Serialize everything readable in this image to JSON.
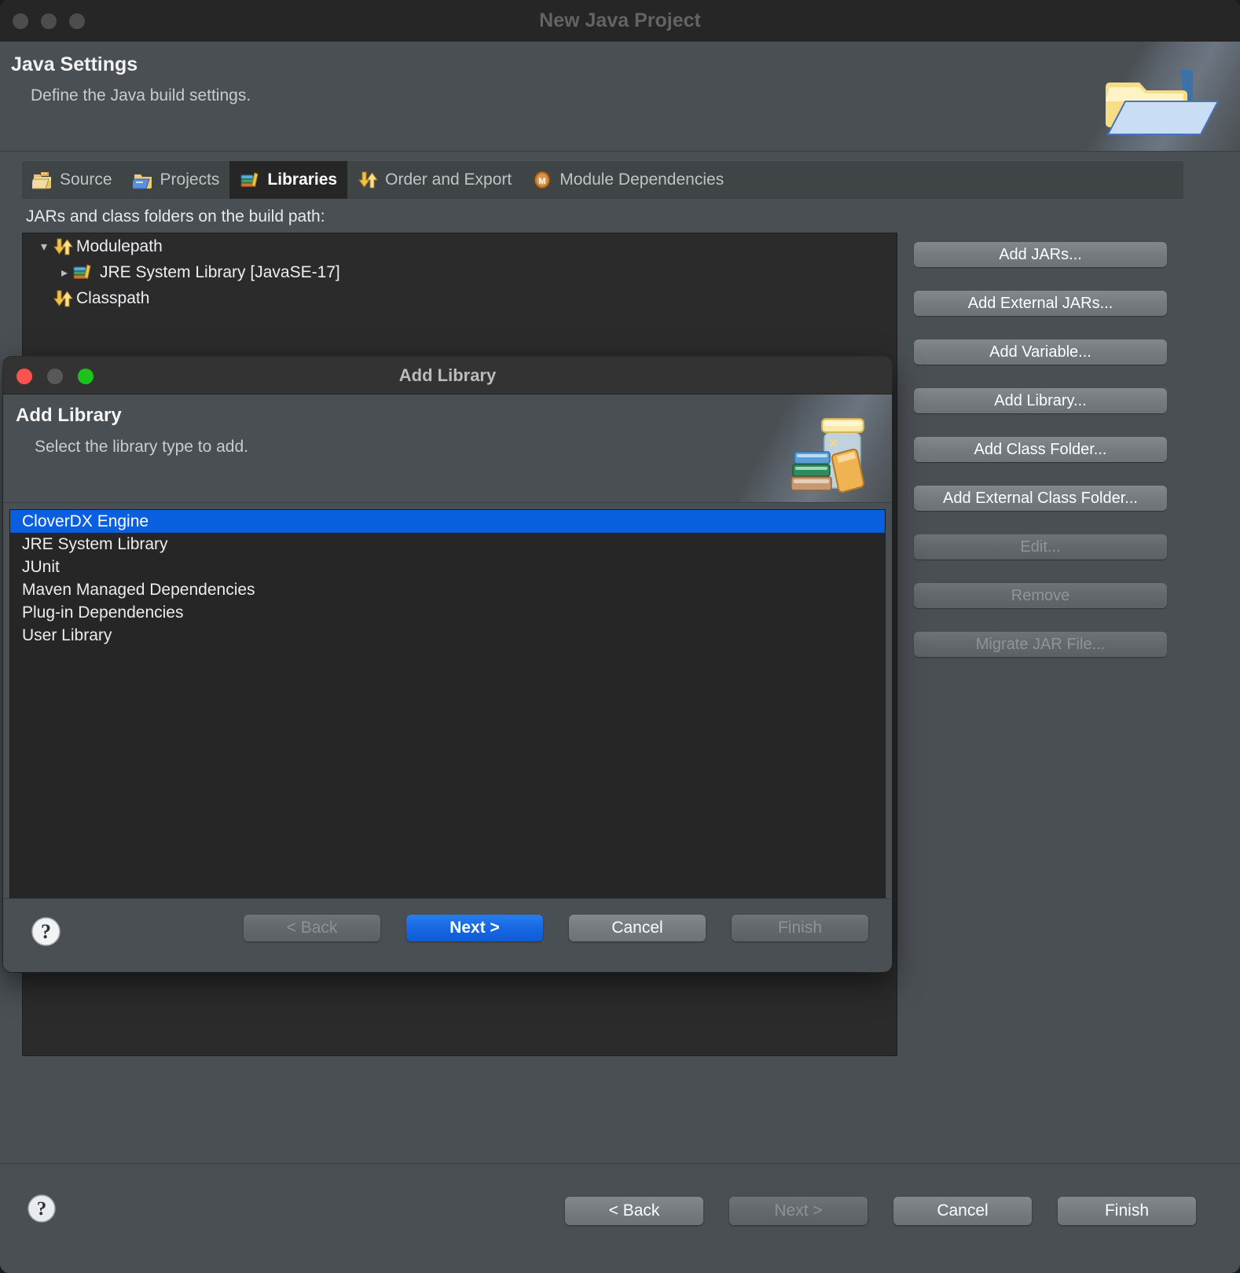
{
  "main_window": {
    "title": "New Java Project",
    "header": {
      "title": "Java Settings",
      "subtitle": "Define the Java build settings.",
      "icon": "java-project-folder-icon"
    },
    "tabs": [
      {
        "label": "Source",
        "icon": "source-folder-icon",
        "active": false
      },
      {
        "label": "Projects",
        "icon": "projects-folder-icon",
        "active": false
      },
      {
        "label": "Libraries",
        "icon": "libraries-books-icon",
        "active": true
      },
      {
        "label": "Order and Export",
        "icon": "order-export-arrows-icon",
        "active": false
      },
      {
        "label": "Module Dependencies",
        "icon": "module-dependencies-icon",
        "active": false
      }
    ],
    "build_path_label": "JARs and class folders on the build path:",
    "tree": [
      {
        "label": "Modulepath",
        "icon": "order-export-arrows-icon",
        "twisty": "expanded",
        "indent": 0
      },
      {
        "label": "JRE System Library [JavaSE-17]",
        "icon": "libraries-books-icon",
        "twisty": "collapsed",
        "indent": 1
      },
      {
        "label": "Classpath",
        "icon": "order-export-arrows-icon",
        "twisty": "none",
        "indent": 0
      }
    ],
    "side_buttons": [
      {
        "label": "Add JARs...",
        "enabled": true,
        "gap_before": false
      },
      {
        "label": "Add External JARs...",
        "enabled": true,
        "gap_before": false
      },
      {
        "label": "Add Variable...",
        "enabled": true,
        "gap_before": false
      },
      {
        "label": "Add Library...",
        "enabled": true,
        "gap_before": false
      },
      {
        "label": "Add Class Folder...",
        "enabled": true,
        "gap_before": false
      },
      {
        "label": "Add External Class Folder...",
        "enabled": true,
        "gap_before": false
      },
      {
        "label": "Edit...",
        "enabled": false,
        "gap_before": true
      },
      {
        "label": "Remove",
        "enabled": false,
        "gap_before": false
      },
      {
        "label": "Migrate JAR File...",
        "enabled": false,
        "gap_before": true
      }
    ],
    "footer": {
      "help_icon": "help-question-icon",
      "buttons": [
        {
          "label": "< Back",
          "enabled": true,
          "primary": false
        },
        {
          "label": "Next >",
          "enabled": false,
          "primary": false
        },
        {
          "label": "Cancel",
          "enabled": true,
          "primary": false
        },
        {
          "label": "Finish",
          "enabled": true,
          "primary": false
        }
      ]
    }
  },
  "dialog": {
    "title": "Add Library",
    "header": {
      "title": "Add Library",
      "subtitle": "Select the library type to add.",
      "icon": "jar-with-books-icon"
    },
    "library_types": [
      {
        "label": "CloverDX Engine",
        "selected": true
      },
      {
        "label": "JRE System Library",
        "selected": false
      },
      {
        "label": "JUnit",
        "selected": false
      },
      {
        "label": "Maven Managed Dependencies",
        "selected": false
      },
      {
        "label": "Plug-in Dependencies",
        "selected": false
      },
      {
        "label": "User Library",
        "selected": false
      }
    ],
    "footer": {
      "help_icon": "help-question-icon",
      "buttons": [
        {
          "label": "< Back",
          "enabled": false,
          "primary": false
        },
        {
          "label": "Next >",
          "enabled": true,
          "primary": true
        },
        {
          "label": "Cancel",
          "enabled": true,
          "primary": false
        },
        {
          "label": "Finish",
          "enabled": false,
          "primary": false
        }
      ]
    }
  },
  "colors": {
    "window_bg": "#4a4f53",
    "list_bg": "#262626",
    "selection_blue": "#0a5fe0",
    "primary_button_blue": "#1566e0",
    "titlebar_bg": "#262626"
  }
}
